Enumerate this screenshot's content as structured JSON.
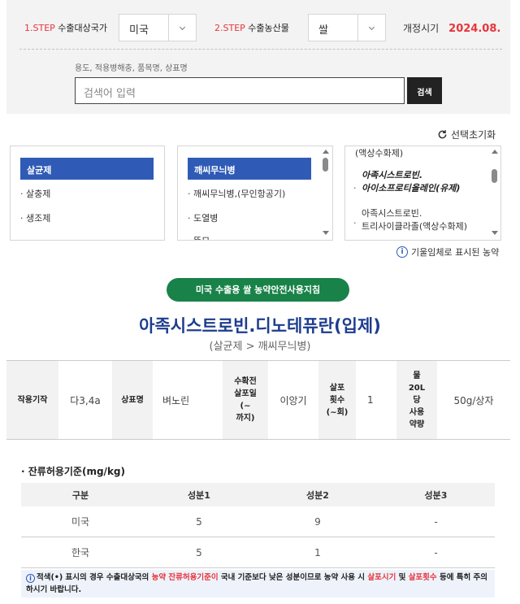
{
  "filters": {
    "step1": {
      "num": "1.STEP",
      "label": "수출대상국가",
      "value": "미국"
    },
    "step2": {
      "num": "2.STEP",
      "label": "수출농산물",
      "value": "쌀"
    },
    "revision": {
      "label": "개정시기",
      "date": "2024.08."
    },
    "search": {
      "hint": "용도, 적용병해충, 품목명, 상표명",
      "placeholder": "검색어 입력",
      "button": "검색"
    }
  },
  "reset_label": "선택초기화",
  "lists": {
    "usage": [
      "살균제",
      "살충제",
      "생조제"
    ],
    "disease": [
      "깨씨무늬병",
      "깨씨무늬병,(무인항공기)",
      "도열병",
      "뜸모"
    ],
    "products": [
      "(액상수화제)",
      "아족시스트로빈.",
      "아이소프로티올레인(유제)",
      "아족시스트로빈.",
      "트리사이클라졸(액상수화제)"
    ]
  },
  "legend": "기울임체로 표시된 농약",
  "guide_button": "미국 수출용 쌀 농약안전사용지침",
  "product": {
    "title": "아족시스트로빈.디노테퓨란(입제)",
    "subtitle": "(살균제 > 깨씨무늬병)"
  },
  "info": {
    "h_mechanism": "작용기작",
    "mechanism": "다3,4a",
    "h_brand": "상표명",
    "brand": "벼노린",
    "h_days": [
      "수확전",
      "살포일",
      "(~",
      "까지)"
    ],
    "days": "이앙기",
    "h_count": [
      "살포",
      "횟수",
      "(~회)"
    ],
    "count": "1",
    "h_amount": [
      "물",
      "20L",
      "당",
      "사용",
      "약량"
    ],
    "amount": "50g/상자"
  },
  "residue": {
    "title": "· 잔류허용기준(mg/kg)",
    "headers": [
      "구분",
      "성분1",
      "성분2",
      "성분3"
    ],
    "rows": [
      [
        "미국",
        "5",
        "9",
        "-"
      ],
      [
        "한국",
        "5",
        "1",
        "-"
      ]
    ]
  },
  "note": {
    "p1": "적색(•) 표시의 경우 수출대상국의 ",
    "r1": "농약 잔류허용기준이",
    "p2": " 국내 기준보다 낮은 성분이므로 농약 사용 시 ",
    "r2": "살포시기",
    "p3": " 및 ",
    "r3": "살포횟수",
    "p4": " 등에 특히 주의하시기 바랍니다."
  },
  "colors": {
    "accent_red": "#e8343c",
    "primary_blue": "#2f5bb7",
    "title_blue": "#1e3d8f",
    "guide_green": "#198248"
  }
}
